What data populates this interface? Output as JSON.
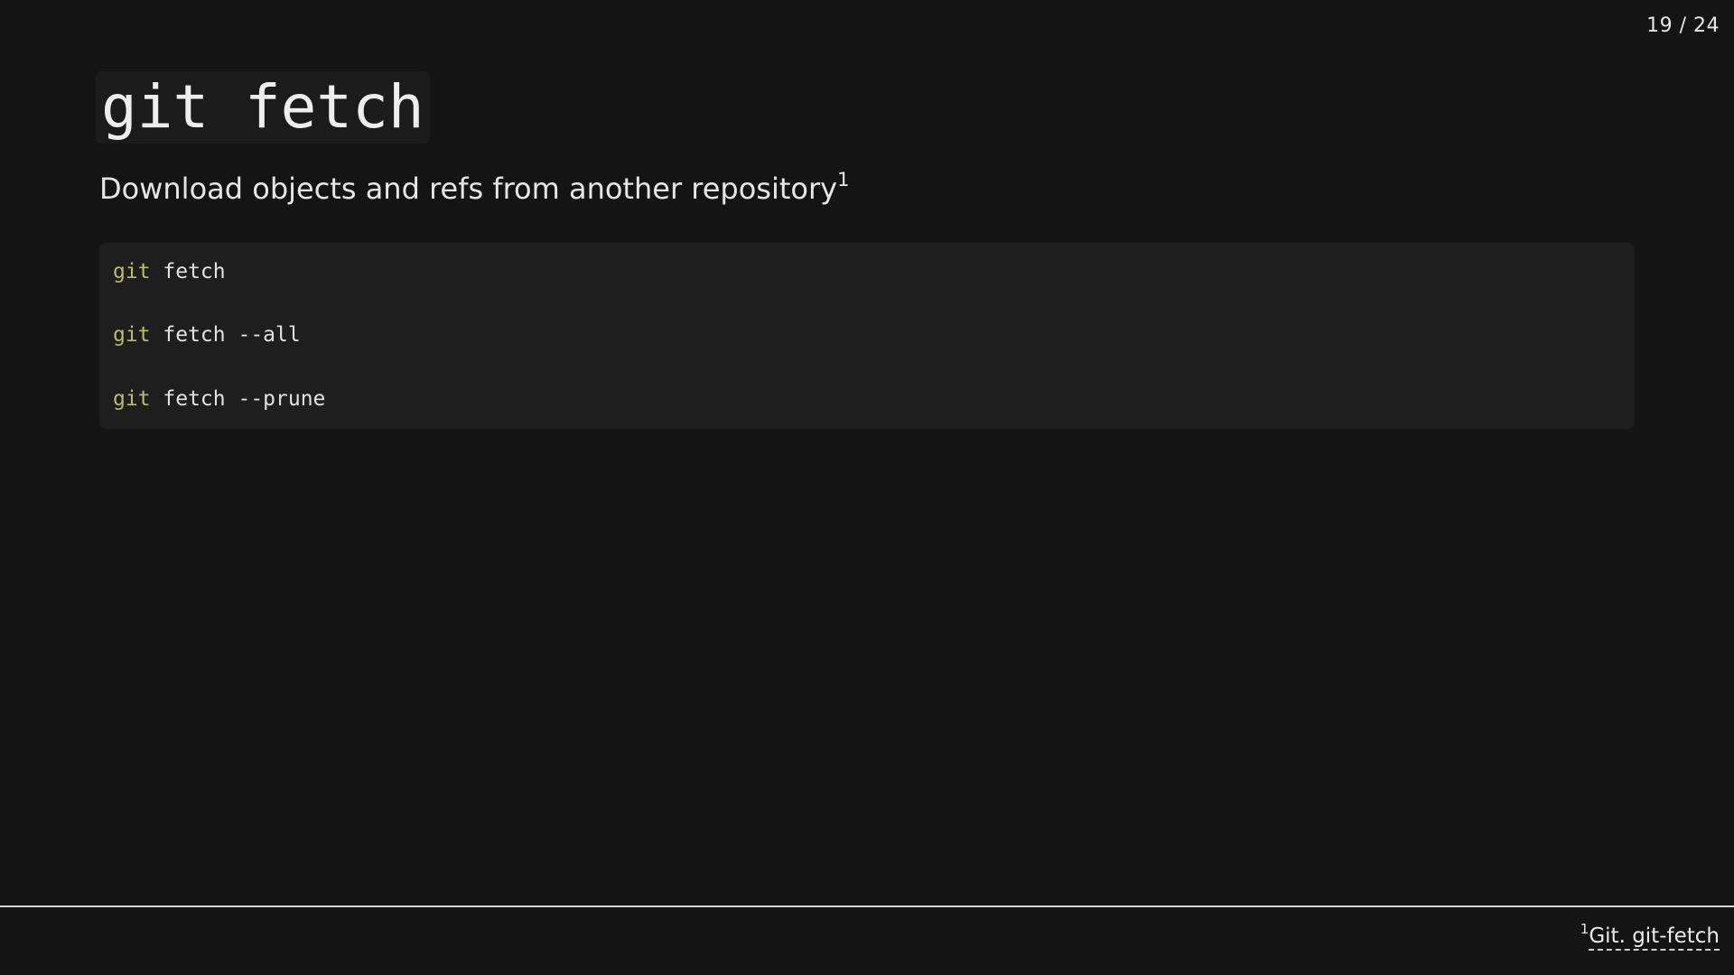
{
  "slide": {
    "counter": "19 / 24",
    "title": "git fetch",
    "subtitle": "Download objects and refs from another repository",
    "subtitle_ref": "1"
  },
  "code": {
    "lines": [
      {
        "keyword": "git",
        "rest": " fetch"
      },
      {
        "keyword": "git",
        "rest": " fetch --all"
      },
      {
        "keyword": "git",
        "rest": " fetch --prune"
      }
    ]
  },
  "footnote": {
    "ref": "1",
    "link_text": "Git. git-fetch"
  },
  "colors": {
    "background": "#141414",
    "code_background": "#1e1e1e",
    "keyword": "#b5bd68",
    "text": "#e8e8e8"
  }
}
